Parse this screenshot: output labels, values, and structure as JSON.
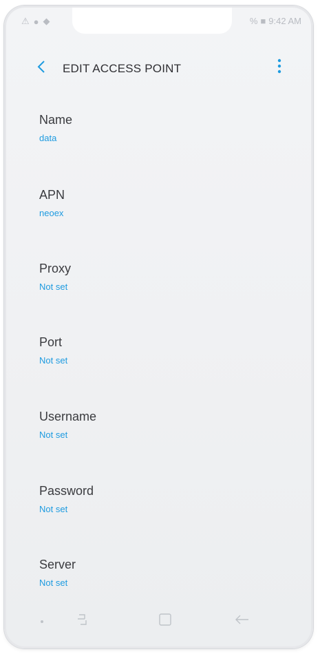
{
  "status_bar": {
    "left_icons": [
      "alert-icon",
      "circle-check-icon",
      "app-icon"
    ],
    "battery_percent_text": "%",
    "time": "9:42 AM"
  },
  "toolbar": {
    "title": "EDIT ACCESS POINT",
    "back_icon": "chevron-left-icon",
    "more_icon": "more-vertical-icon"
  },
  "fields": [
    {
      "label": "Name",
      "value": "data"
    },
    {
      "label": "APN",
      "value": "neoex"
    },
    {
      "label": "Proxy",
      "value": "Not set"
    },
    {
      "label": "Port",
      "value": "Not set"
    },
    {
      "label": "Username",
      "value": "Not set"
    },
    {
      "label": "Password",
      "value": "Not set"
    },
    {
      "label": "Server",
      "value": "Not set"
    }
  ],
  "nav_bar": {
    "icons": [
      "dot-icon",
      "recents-icon",
      "home-icon",
      "back-arrow-icon"
    ]
  },
  "colors": {
    "accent": "#1e9be0",
    "background": "#f1f2f4",
    "text": "#3a3b3f"
  }
}
